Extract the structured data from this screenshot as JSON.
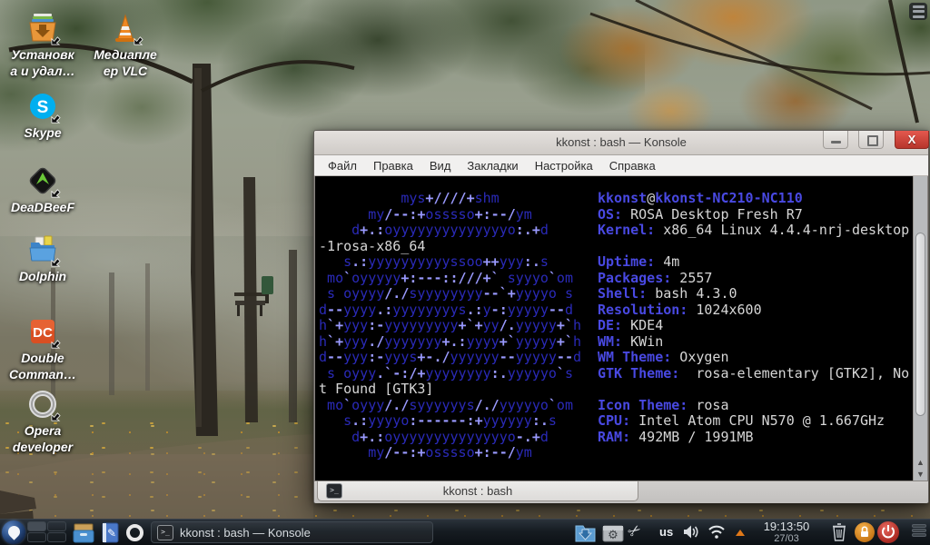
{
  "window": {
    "title": "kkonst : bash — Konsole",
    "menu": [
      "Файл",
      "Правка",
      "Вид",
      "Закладки",
      "Настройка",
      "Справка"
    ],
    "tab_label": "kkonst : bash",
    "terminal_icon_glyph": ">_"
  },
  "terminal": {
    "colors": {
      "background": "#000000",
      "art_blue": "#2a2ab8",
      "art_bright": "#9a9aff",
      "label_blue": "#4949e2",
      "text": "#d6d6d6"
    },
    "rows": [
      {
        "art": "          mys+////+shm",
        "info": [
          [
            "b",
            "kkonst"
          ],
          [
            "w",
            "@"
          ],
          [
            "b",
            "kkonst-NC210-NC110"
          ]
        ]
      },
      {
        "art": "      my/--:+osssso+:--/ym",
        "info": [
          [
            "b",
            "OS:"
          ],
          [
            "w",
            " ROSA Desktop Fresh R7"
          ]
        ]
      },
      {
        "art": "    d+.:oyyyyyyyyyyyyyyo:.+d",
        "info": [
          [
            "b",
            "Kernel:"
          ],
          [
            "w",
            " x86_64 Linux 4.4.4-nrj-desktop"
          ]
        ]
      },
      {
        "wrap": "-1rosa-x86_64"
      },
      {
        "art": "   s.:yyyyyyyyyyssoo++yyy:.s",
        "info": [
          [
            "b",
            "Uptime:"
          ],
          [
            "w",
            " 4m"
          ]
        ]
      },
      {
        "art": " mo`oyyyyy+:---::///+` syyyo`om",
        "info": [
          [
            "b",
            "Packages:"
          ],
          [
            "w",
            " 2557"
          ]
        ]
      },
      {
        "art": " s oyyyy/./syyyyyyyy--`+yyyyo s",
        "info": [
          [
            "b",
            "Shell:"
          ],
          [
            "w",
            " bash 4.3.0"
          ]
        ]
      },
      {
        "art": "d--yyyy.:yyyyyyyys.:y-:yyyyy--d",
        "info": [
          [
            "b",
            "Resolution:"
          ],
          [
            "w",
            " 1024x600"
          ]
        ]
      },
      {
        "art": "h`+yyy:-yyyyyyyyy+`+yy/.yyyyy+`h",
        "info": [
          [
            "b",
            "DE:"
          ],
          [
            "w",
            " KDE4"
          ]
        ]
      },
      {
        "art": "h`+yyy./yyyyyyy+.:yyyy+`yyyyy+`h",
        "info": [
          [
            "b",
            "WM:"
          ],
          [
            "w",
            " KWin"
          ]
        ]
      },
      {
        "art": "d--yyy:-yyys+-./yyyyyy--yyyyy--d",
        "info": [
          [
            "b",
            "WM Theme:"
          ],
          [
            "w",
            " Oxygen"
          ]
        ]
      },
      {
        "art": " s oyyy.`-:/+yyyyyyyy:.yyyyyo`s",
        "info": [
          [
            "b",
            "GTK Theme:"
          ],
          [
            "w",
            "  rosa-elementary [GTK2], No"
          ]
        ]
      },
      {
        "wrap": "t Found [GTK3]"
      },
      {
        "art": " mo`oyyy/./syyyyyys/./yyyyyo`om",
        "info": [
          [
            "b",
            "Icon Theme:"
          ],
          [
            "w",
            " rosa"
          ]
        ]
      },
      {
        "art": "   s.:yyyyo:------:+yyyyyy:.s",
        "info": [
          [
            "b",
            "CPU:"
          ],
          [
            "w",
            " Intel Atom CPU N570 @ 1.667GHz"
          ]
        ]
      },
      {
        "art": "    d+.:oyyyyyyyyyyyyyyo-.+d",
        "info": [
          [
            "b",
            "RAM:"
          ],
          [
            "w",
            " 492MB / 1991MB"
          ]
        ]
      },
      {
        "art": "      my/--:+osssso+:--/ym"
      }
    ]
  },
  "desktop_icons": [
    {
      "id": "install-remove",
      "label1": "Установк",
      "label2": "а и удал…"
    },
    {
      "id": "vlc",
      "label1": "Медиапле",
      "label2": "ер VLC"
    },
    {
      "id": "skype",
      "label1": "Skype",
      "label2": "",
      "icon_text": "S"
    },
    {
      "id": "deadbeef",
      "label1": "DeaDBeeF",
      "label2": ""
    },
    {
      "id": "dolphin",
      "label1": "Dolphin",
      "label2": ""
    },
    {
      "id": "double-commander",
      "label1": "Double",
      "label2": "Comman…",
      "icon_text": "DC"
    },
    {
      "id": "opera-developer",
      "label1": "Opera",
      "label2": "developer"
    }
  ],
  "taskbar": {
    "task_label": "kkonst : bash — Konsole",
    "keyboard_layout": "us",
    "clock": {
      "time": "19:13:50",
      "date": "27/03"
    }
  }
}
